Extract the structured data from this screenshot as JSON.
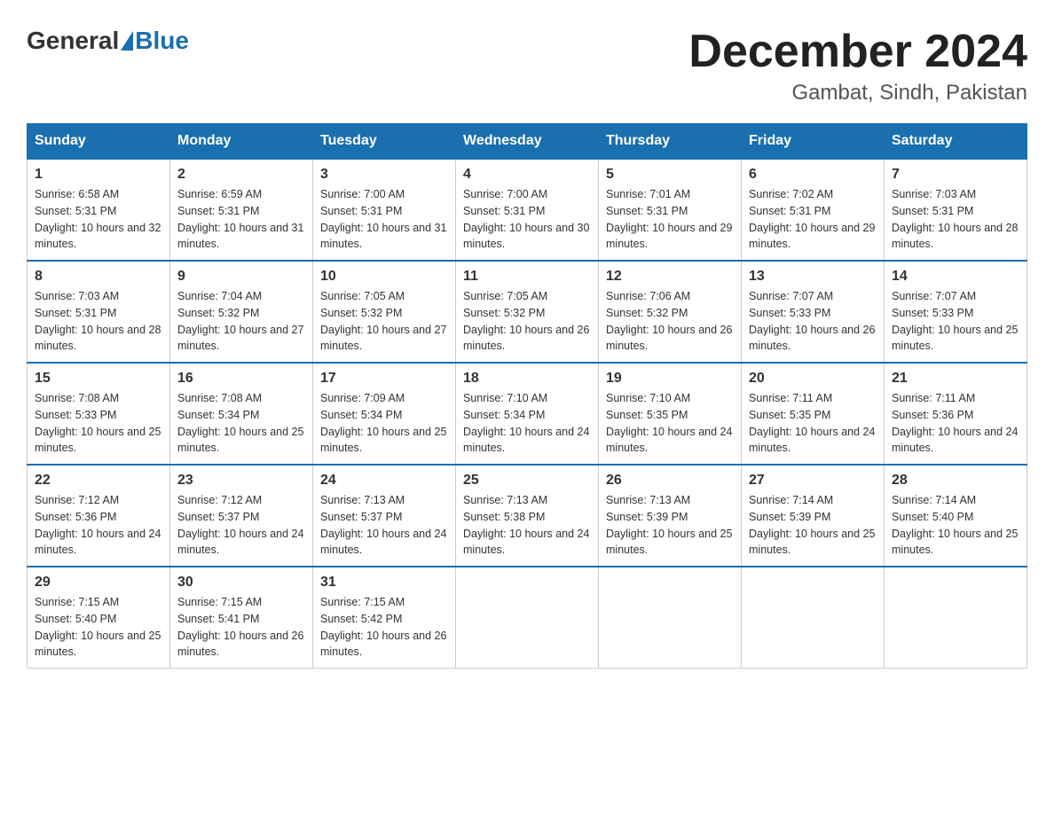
{
  "logo": {
    "general": "General",
    "blue": "Blue"
  },
  "title": "December 2024",
  "location": "Gambat, Sindh, Pakistan",
  "weekdays": [
    "Sunday",
    "Monday",
    "Tuesday",
    "Wednesday",
    "Thursday",
    "Friday",
    "Saturday"
  ],
  "weeks": [
    [
      {
        "day": "1",
        "sunrise": "6:58 AM",
        "sunset": "5:31 PM",
        "daylight": "10 hours and 32 minutes."
      },
      {
        "day": "2",
        "sunrise": "6:59 AM",
        "sunset": "5:31 PM",
        "daylight": "10 hours and 31 minutes."
      },
      {
        "day": "3",
        "sunrise": "7:00 AM",
        "sunset": "5:31 PM",
        "daylight": "10 hours and 31 minutes."
      },
      {
        "day": "4",
        "sunrise": "7:00 AM",
        "sunset": "5:31 PM",
        "daylight": "10 hours and 30 minutes."
      },
      {
        "day": "5",
        "sunrise": "7:01 AM",
        "sunset": "5:31 PM",
        "daylight": "10 hours and 29 minutes."
      },
      {
        "day": "6",
        "sunrise": "7:02 AM",
        "sunset": "5:31 PM",
        "daylight": "10 hours and 29 minutes."
      },
      {
        "day": "7",
        "sunrise": "7:03 AM",
        "sunset": "5:31 PM",
        "daylight": "10 hours and 28 minutes."
      }
    ],
    [
      {
        "day": "8",
        "sunrise": "7:03 AM",
        "sunset": "5:31 PM",
        "daylight": "10 hours and 28 minutes."
      },
      {
        "day": "9",
        "sunrise": "7:04 AM",
        "sunset": "5:32 PM",
        "daylight": "10 hours and 27 minutes."
      },
      {
        "day": "10",
        "sunrise": "7:05 AM",
        "sunset": "5:32 PM",
        "daylight": "10 hours and 27 minutes."
      },
      {
        "day": "11",
        "sunrise": "7:05 AM",
        "sunset": "5:32 PM",
        "daylight": "10 hours and 26 minutes."
      },
      {
        "day": "12",
        "sunrise": "7:06 AM",
        "sunset": "5:32 PM",
        "daylight": "10 hours and 26 minutes."
      },
      {
        "day": "13",
        "sunrise": "7:07 AM",
        "sunset": "5:33 PM",
        "daylight": "10 hours and 26 minutes."
      },
      {
        "day": "14",
        "sunrise": "7:07 AM",
        "sunset": "5:33 PM",
        "daylight": "10 hours and 25 minutes."
      }
    ],
    [
      {
        "day": "15",
        "sunrise": "7:08 AM",
        "sunset": "5:33 PM",
        "daylight": "10 hours and 25 minutes."
      },
      {
        "day": "16",
        "sunrise": "7:08 AM",
        "sunset": "5:34 PM",
        "daylight": "10 hours and 25 minutes."
      },
      {
        "day": "17",
        "sunrise": "7:09 AM",
        "sunset": "5:34 PM",
        "daylight": "10 hours and 25 minutes."
      },
      {
        "day": "18",
        "sunrise": "7:10 AM",
        "sunset": "5:34 PM",
        "daylight": "10 hours and 24 minutes."
      },
      {
        "day": "19",
        "sunrise": "7:10 AM",
        "sunset": "5:35 PM",
        "daylight": "10 hours and 24 minutes."
      },
      {
        "day": "20",
        "sunrise": "7:11 AM",
        "sunset": "5:35 PM",
        "daylight": "10 hours and 24 minutes."
      },
      {
        "day": "21",
        "sunrise": "7:11 AM",
        "sunset": "5:36 PM",
        "daylight": "10 hours and 24 minutes."
      }
    ],
    [
      {
        "day": "22",
        "sunrise": "7:12 AM",
        "sunset": "5:36 PM",
        "daylight": "10 hours and 24 minutes."
      },
      {
        "day": "23",
        "sunrise": "7:12 AM",
        "sunset": "5:37 PM",
        "daylight": "10 hours and 24 minutes."
      },
      {
        "day": "24",
        "sunrise": "7:13 AM",
        "sunset": "5:37 PM",
        "daylight": "10 hours and 24 minutes."
      },
      {
        "day": "25",
        "sunrise": "7:13 AM",
        "sunset": "5:38 PM",
        "daylight": "10 hours and 24 minutes."
      },
      {
        "day": "26",
        "sunrise": "7:13 AM",
        "sunset": "5:39 PM",
        "daylight": "10 hours and 25 minutes."
      },
      {
        "day": "27",
        "sunrise": "7:14 AM",
        "sunset": "5:39 PM",
        "daylight": "10 hours and 25 minutes."
      },
      {
        "day": "28",
        "sunrise": "7:14 AM",
        "sunset": "5:40 PM",
        "daylight": "10 hours and 25 minutes."
      }
    ],
    [
      {
        "day": "29",
        "sunrise": "7:15 AM",
        "sunset": "5:40 PM",
        "daylight": "10 hours and 25 minutes."
      },
      {
        "day": "30",
        "sunrise": "7:15 AM",
        "sunset": "5:41 PM",
        "daylight": "10 hours and 26 minutes."
      },
      {
        "day": "31",
        "sunrise": "7:15 AM",
        "sunset": "5:42 PM",
        "daylight": "10 hours and 26 minutes."
      },
      null,
      null,
      null,
      null
    ]
  ]
}
